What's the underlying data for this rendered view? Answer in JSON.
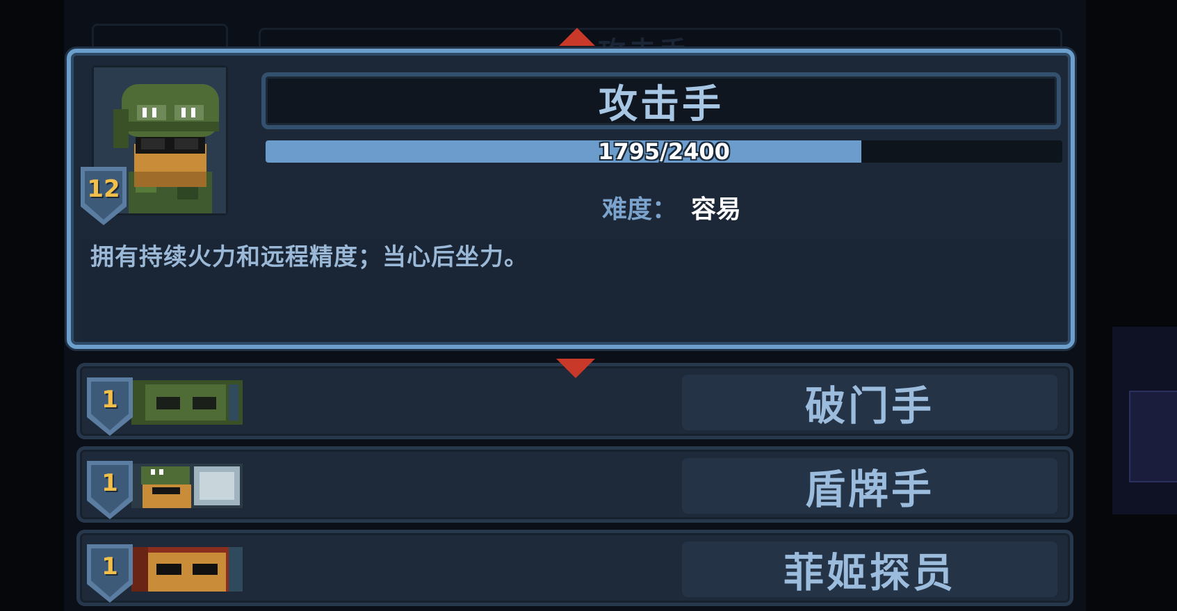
{
  "selected": {
    "name": "攻击手",
    "level": "12",
    "xp_text": "1795/2400",
    "xp_fraction": 0.748,
    "difficulty_label": "难度：",
    "difficulty_value": "容易",
    "description": "拥有持续火力和远程精度；当心后坐力。"
  },
  "background_title": "攻击手",
  "list": [
    {
      "level": "1",
      "name": "破门手"
    },
    {
      "level": "1",
      "name": "盾牌手"
    },
    {
      "level": "1",
      "name": "菲姬探员"
    }
  ],
  "icons": {
    "up": "arrow-up-icon",
    "down": "arrow-down-icon"
  },
  "colors": {
    "accent_border": "#6d9fcd",
    "xp_fill": "#6b9ccb",
    "level_text": "#f2c04a",
    "arrow": "#c8392a"
  }
}
